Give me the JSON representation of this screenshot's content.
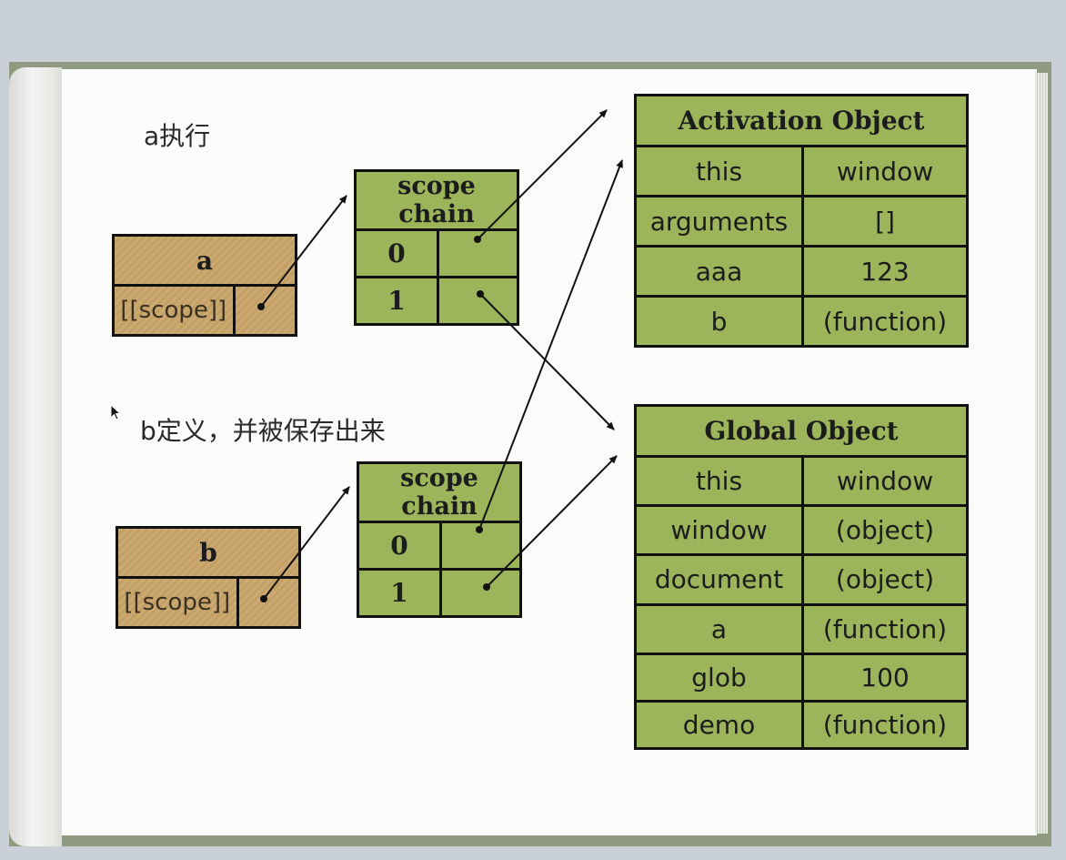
{
  "captions": {
    "a_exec": "a执行",
    "b_defined": "b定义，并被保存出来"
  },
  "func_a": {
    "name": "a",
    "scope_label": "[[scope]]"
  },
  "func_b": {
    "name": "b",
    "scope_label": "[[scope]]"
  },
  "chain_a": {
    "title": "scope chain",
    "rows": [
      "0",
      "1"
    ]
  },
  "chain_b": {
    "title": "scope chain",
    "rows": [
      "0",
      "1"
    ]
  },
  "activation_object": {
    "title": "Activation Object",
    "rows": [
      {
        "key": "this",
        "value": "window"
      },
      {
        "key": "arguments",
        "value": "[]"
      },
      {
        "key": "aaa",
        "value": "123"
      },
      {
        "key": "b",
        "value": "(function)"
      }
    ]
  },
  "global_object": {
    "title": "Global Object",
    "rows": [
      {
        "key": "this",
        "value": "window"
      },
      {
        "key": "window",
        "value": "(object)"
      },
      {
        "key": "document",
        "value": "(object)"
      },
      {
        "key": "a",
        "value": "(function)"
      },
      {
        "key": "glob",
        "value": "100"
      },
      {
        "key": "demo",
        "value": "(function)"
      }
    ]
  },
  "colors": {
    "box_green": "#9db55a",
    "box_tan": "#c8a468",
    "border": "#111111"
  }
}
